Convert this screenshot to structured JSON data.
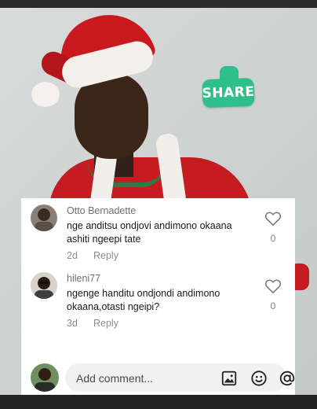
{
  "sticker": {
    "label": "SHARE"
  },
  "comments": [
    {
      "author": "Otto Bernadette",
      "text": "nge anditsu ondjovi andimono okaana ashiti ngeepi tate",
      "time": "2d",
      "reply_label": "Reply",
      "likes": "0"
    },
    {
      "author": "hileni77",
      "text": "ngenge handitu ondjondi andimono okaana,otasti ngeipi?",
      "time": "3d",
      "reply_label": "Reply",
      "likes": "0"
    }
  ],
  "composer": {
    "placeholder": "Add comment...",
    "icons": [
      "image-icon",
      "emoji-icon",
      "mention-icon"
    ]
  },
  "colors": {
    "sticker": "#2fbf8a",
    "santa_red": "#c51c21",
    "panel_bg": "#ffffff",
    "muted_text": "#8c8c8c"
  }
}
